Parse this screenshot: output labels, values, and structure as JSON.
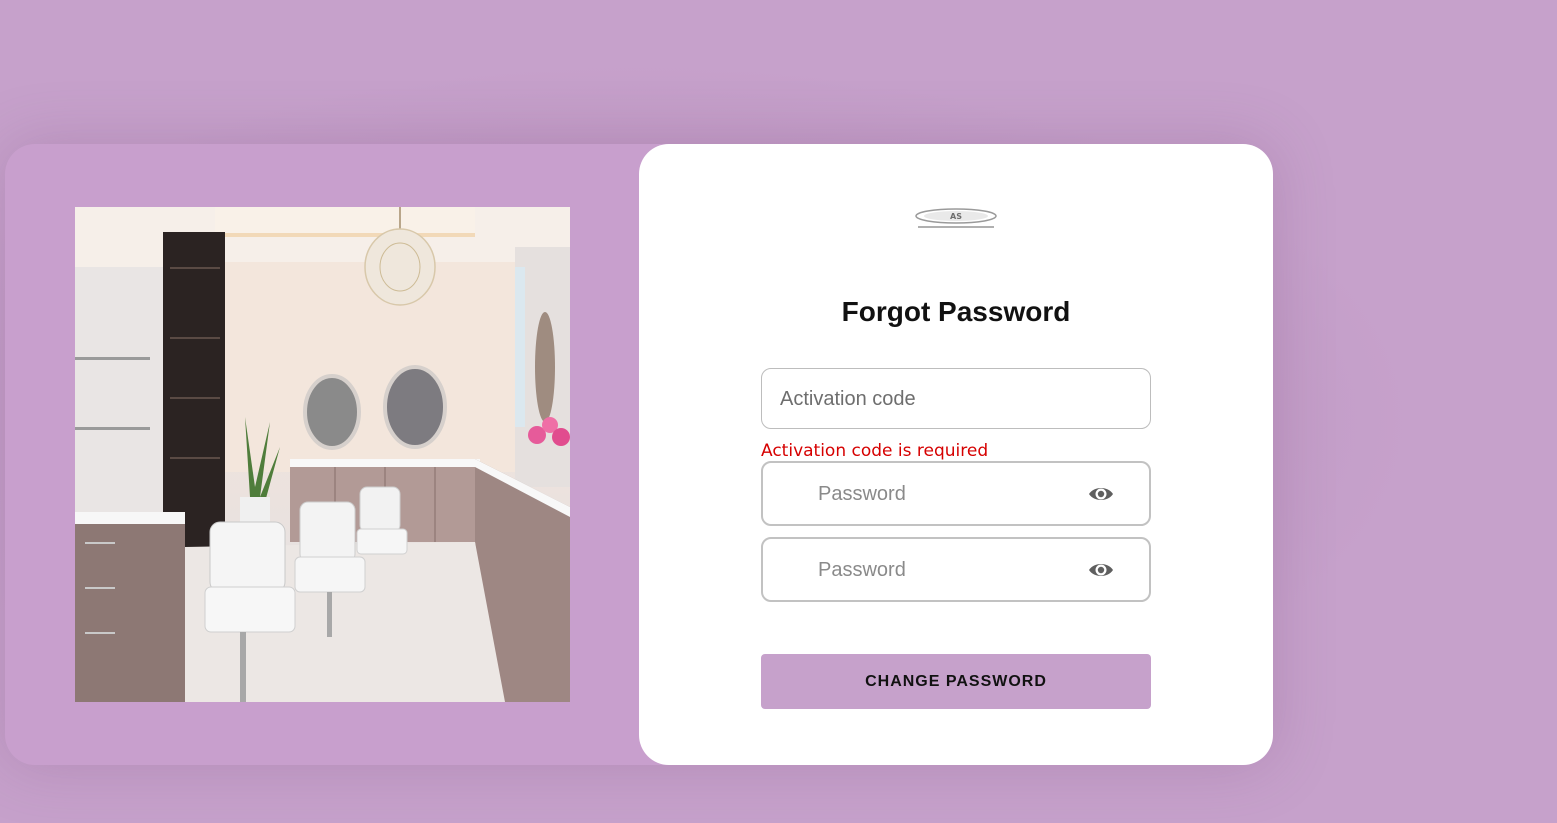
{
  "form": {
    "title": "Forgot Password",
    "activation_code_placeholder": "Activation code",
    "activation_code_value": "",
    "activation_code_error": "Activation code is required",
    "password_placeholder": "Password",
    "confirm_password_placeholder": "Password",
    "submit_label": "CHANGE PASSWORD"
  },
  "icons": {
    "password_toggle": "eye-icon",
    "confirm_password_toggle": "eye-icon"
  },
  "colors": {
    "background": "#c6a1cb",
    "button": "#c6a1cb",
    "error": "#d60000",
    "panel": "#ffffff"
  }
}
